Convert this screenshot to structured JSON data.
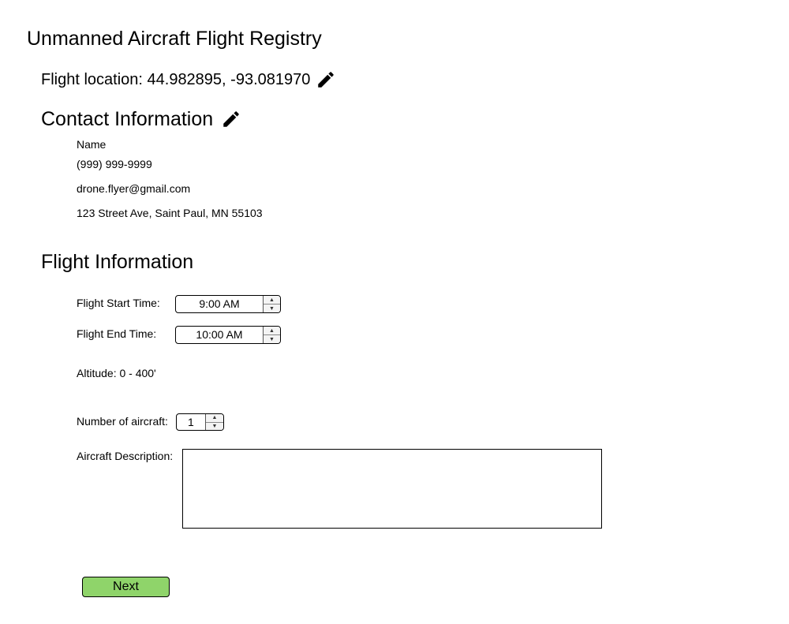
{
  "page": {
    "title": "Unmanned Aircraft Flight Registry"
  },
  "location": {
    "label": "Flight location: 44.982895, -93.081970",
    "edit_icon": "pencil-icon"
  },
  "contact": {
    "heading": "Contact Information",
    "edit_icon": "pencil-icon",
    "name": "Name",
    "phone": "(999) 999-9999",
    "email": "drone.flyer@gmail.com",
    "address": "123 Street Ave, Saint Paul, MN 55103"
  },
  "flight": {
    "heading": "Flight Information",
    "start_label": "Flight Start Time:",
    "start_value": "9:00 AM",
    "end_label": "Flight End Time:",
    "end_value": "10:00 AM",
    "altitude": "Altitude: 0 - 400'",
    "count_label": "Number of aircraft:",
    "count_value": "1",
    "description_label": "Aircraft Description:",
    "description_value": ""
  },
  "actions": {
    "next_label": "Next",
    "next_color": "#8fd46a"
  }
}
